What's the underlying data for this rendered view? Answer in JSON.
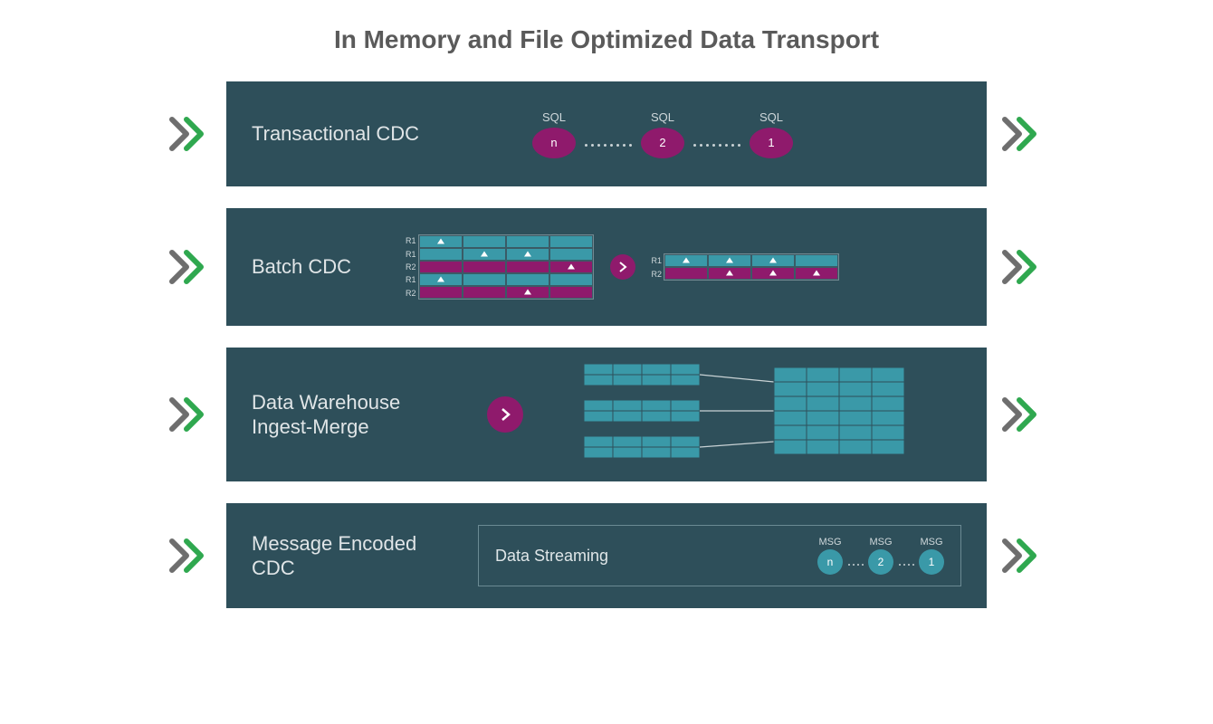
{
  "title": "In Memory and File Optimized Data Transport",
  "colors": {
    "panel_bg": "#2e4f5a",
    "magenta": "#8f1a6c",
    "teal": "#3a99a8",
    "chevron_grey": "#6e6e6e",
    "chevron_green": "#2fa84f"
  },
  "rows": [
    {
      "label": "Transactional CDC",
      "sql_nodes": [
        {
          "header": "SQL",
          "value": "n"
        },
        {
          "header": "SQL",
          "value": "2"
        },
        {
          "header": "SQL",
          "value": "1"
        }
      ]
    },
    {
      "label": "Batch CDC",
      "left_rows": [
        "R1",
        "R1",
        "R2",
        "R1",
        "R2"
      ],
      "right_rows": [
        "R1",
        "R2"
      ]
    },
    {
      "label": "Data Warehouse Ingest-Merge"
    },
    {
      "label": "Message Encoded CDC",
      "stream_title": "Data Streaming",
      "msg_nodes": [
        {
          "header": "MSG",
          "value": "n"
        },
        {
          "header": "MSG",
          "value": "2"
        },
        {
          "header": "MSG",
          "value": "1"
        }
      ]
    }
  ]
}
